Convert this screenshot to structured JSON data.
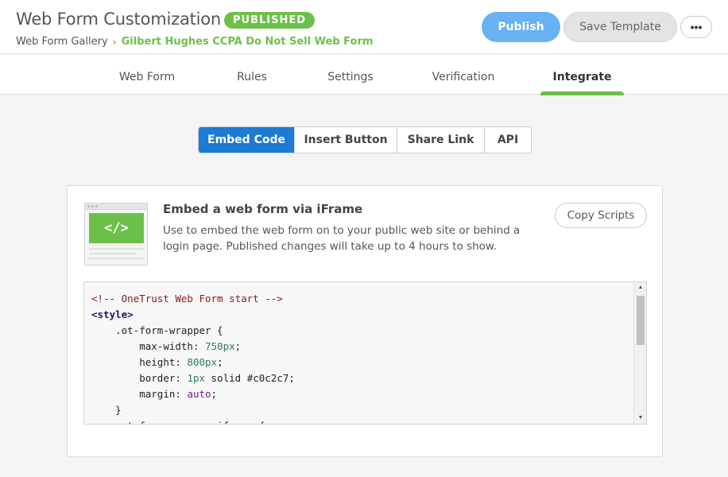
{
  "header": {
    "title": "Web Form Customization",
    "status_badge": "PUBLISHED",
    "breadcrumb": {
      "parent": "Web Form Gallery",
      "current": "Gilbert Hughes CCPA Do Not Sell Web Form"
    },
    "publish_label": "Publish",
    "save_template_label": "Save Template",
    "more_label": "•••"
  },
  "tabs": [
    {
      "label": "Web Form"
    },
    {
      "label": "Rules"
    },
    {
      "label": "Settings"
    },
    {
      "label": "Verification"
    },
    {
      "label": "Integrate",
      "active": true
    }
  ],
  "integrate_tabs": [
    {
      "label": "Embed Code",
      "active": true
    },
    {
      "label": "Insert Button"
    },
    {
      "label": "Share Link"
    },
    {
      "label": "API"
    }
  ],
  "card": {
    "illustration_label": "</>",
    "title": "Embed a web form via iFrame",
    "description": "Use to embed the web form on to your public web site or behind a login page. Published changes will take up to 4 hours to show.",
    "copy_label": "Copy Scripts",
    "code_lines": [
      {
        "comment": "<!-- OneTrust Web Form start -->"
      },
      {
        "tag": "<style>"
      },
      {
        "indent": "    ",
        "selector": ".ot-form-wrapper {"
      },
      {
        "indent": "        ",
        "prop": "max-width",
        "value": "750px"
      },
      {
        "indent": "        ",
        "prop": "height",
        "value": "800px"
      },
      {
        "indent": "        ",
        "prop": "border",
        "value": "1px",
        "rest": " solid #c0c2c7"
      },
      {
        "indent": "        ",
        "prop": "margin",
        "value": "auto",
        "kw": true
      },
      {
        "indent": "    ",
        "selector": "}"
      },
      {
        "indent": "    ",
        "selector": ".ot-form-wrapper iframe {"
      }
    ]
  },
  "colors": {
    "accent_green": "#6cc04a",
    "primary_blue": "#1c7bd3",
    "publish_blue": "#68b1f2"
  }
}
